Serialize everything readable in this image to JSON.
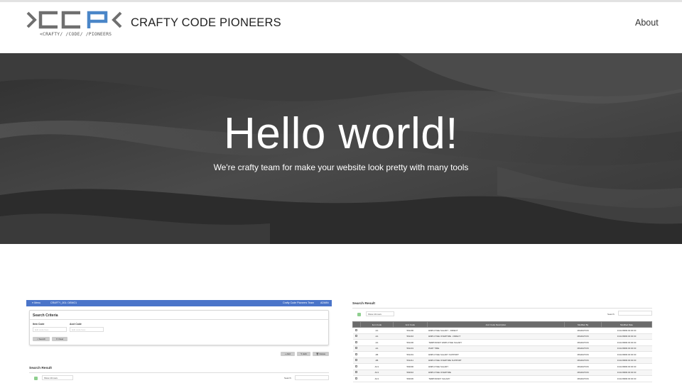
{
  "header": {
    "logo_text": "CCP",
    "logo_subtitle": "<CRAFTY/ /CODE/ /PIONEERS",
    "brand_name": "CRAFTY CODE PIONEERS",
    "nav_about": "About"
  },
  "hero": {
    "heading": "Hello world!",
    "tagline": "We're crafty team for make your website look pretty with many tools"
  },
  "screenshot1": {
    "menu_label": "≡ Menu",
    "app_title": "CRAFTY_001: DEMO1",
    "team_label": "Crafty Code Pioneers Team",
    "user_label": "ADMIN",
    "criteria_title": "Search Criteria",
    "item_code_label": "Item Code",
    "item_code_placeholder": "Edit code here",
    "acct_code_label": "Acct Code",
    "acct_code_placeholder": "Edit code here",
    "search_button": "⌕ Search",
    "clear_button": "✕ Clear",
    "add_button": "+ Add",
    "edit_button": "✎ Edit",
    "delete_button": "🗑 Delete",
    "result_title": "Search Result",
    "show_rows": "Show 10 rows",
    "search_label": "Search:"
  },
  "screenshot2": {
    "result_title": "Search Result",
    "show_rows": "Show 10 rows",
    "search_label": "Search:",
    "columns": [
      "",
      "Item Code",
      "Acct Code",
      "Acct Code Description",
      "Modified By",
      "Modified Date"
    ],
    "rows": [
      [
        "AA",
        "591200",
        "EMPLOYEE SALARY - DIRECT",
        "MIGRATION",
        "31/12/9999 00:00:00"
      ],
      [
        "AA",
        "591210",
        "EMPLOYEE OVERTIME - DIRECT",
        "MIGRATION",
        "31/12/9999 00:00:00"
      ],
      [
        "AA",
        "591230",
        "TEMPORARY EMPLOYEE SALARY",
        "MIGRATION",
        "31/12/9999 00:00:00"
      ],
      [
        "AA",
        "591231",
        "PART TIME",
        "MIGRATION",
        "31/12/9999 00:00:00"
      ],
      [
        "AB",
        "591201",
        "EMPLOYEE SALARY SUPPORT",
        "MIGRATION",
        "31/12/9999 00:00:00"
      ],
      [
        "AB",
        "591211",
        "EMPLOYEE OVERTIME SUPPORT",
        "MIGRATION",
        "31/12/9999 00:00:00"
      ],
      [
        "AC1",
        "592000",
        "EMPLOYEE SALARY",
        "MIGRATION",
        "31/12/9999 00:00:00"
      ],
      [
        "AC1",
        "592010",
        "EMPLOYEE OVERTIME",
        "MIGRATION",
        "31/12/9999 00:00:00"
      ],
      [
        "AC1",
        "592030",
        "TEMPORARY SALARY",
        "MIGRATION",
        "31/12/9999 00:00:00"
      ]
    ]
  },
  "colors": {
    "logo_gray": "#6f6f6f",
    "logo_blue": "#4a86c8",
    "app_topbar_blue": "#4a74c9",
    "table_header_gray": "#6b6b6b"
  }
}
